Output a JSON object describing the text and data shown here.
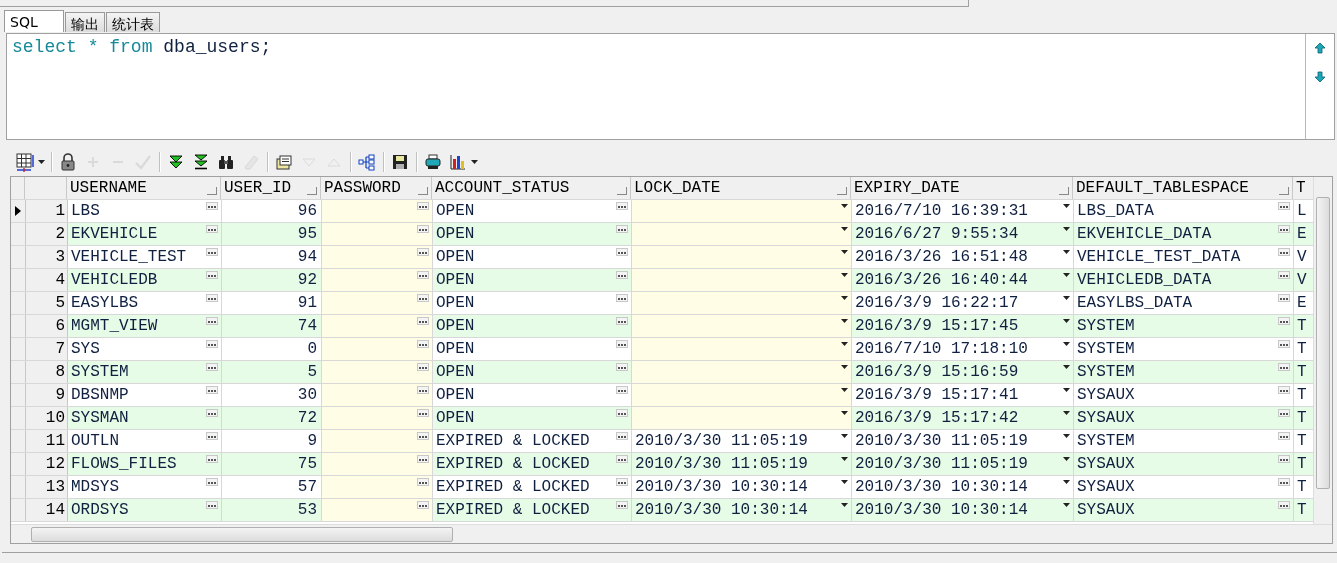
{
  "tabs": [
    {
      "label": "SQL",
      "selected": true
    },
    {
      "label": "输出",
      "selected": false
    },
    {
      "label": "统计表",
      "selected": false
    }
  ],
  "sql": [
    {
      "text": "select",
      "kind": "keyword"
    },
    {
      "text": "*",
      "kind": "keyword"
    },
    {
      "text": "from",
      "kind": "keyword"
    },
    {
      "text": "dba_users;",
      "kind": "ident"
    }
  ],
  "toolbar": [
    {
      "kind": "grid",
      "disabled": false,
      "menu": true
    },
    {
      "kind": "sep"
    },
    {
      "kind": "lock",
      "disabled": false
    },
    {
      "kind": "plus",
      "disabled": true
    },
    {
      "kind": "minus",
      "disabled": true
    },
    {
      "kind": "check",
      "disabled": true
    },
    {
      "kind": "sep"
    },
    {
      "kind": "next",
      "disabled": false
    },
    {
      "kind": "last",
      "disabled": false
    },
    {
      "kind": "find",
      "disabled": false
    },
    {
      "kind": "eraser",
      "disabled": true
    },
    {
      "kind": "sep"
    },
    {
      "kind": "query",
      "disabled": false
    },
    {
      "kind": "down",
      "disabled": true
    },
    {
      "kind": "up",
      "disabled": true
    },
    {
      "kind": "sep"
    },
    {
      "kind": "tree",
      "disabled": false
    },
    {
      "kind": "sep"
    },
    {
      "kind": "save",
      "disabled": false
    },
    {
      "kind": "sep"
    },
    {
      "kind": "print",
      "disabled": false
    },
    {
      "kind": "chart",
      "disabled": false,
      "menu": true
    }
  ],
  "table": {
    "columns": [
      {
        "label": "USERNAME",
        "kind": "text"
      },
      {
        "label": "USER_ID",
        "kind": "number"
      },
      {
        "label": "PASSWORD",
        "kind": "text"
      },
      {
        "label": "ACCOUNT_STATUS",
        "kind": "text"
      },
      {
        "label": "LOCK_DATE",
        "kind": "date"
      },
      {
        "label": "EXPIRY_DATE",
        "kind": "date"
      },
      {
        "label": "DEFAULT_TABLESPACE",
        "kind": "text"
      },
      {
        "label": "T",
        "kind": "plain"
      }
    ],
    "rows": [
      {
        "number": "1",
        "selected": true,
        "cells": [
          "LBS",
          "96",
          null,
          "OPEN",
          null,
          "2016/7/10 16:39:31",
          "LBS_DATA",
          "L"
        ]
      },
      {
        "number": "2",
        "selected": false,
        "cells": [
          "EKVEHICLE",
          "95",
          null,
          "OPEN",
          null,
          "2016/6/27 9:55:34",
          "EKVEHICLE_DATA",
          "E"
        ]
      },
      {
        "number": "3",
        "selected": false,
        "cells": [
          "VEHICLE_TEST",
          "94",
          null,
          "OPEN",
          null,
          "2016/3/26 16:51:48",
          "VEHICLE_TEST_DATA",
          "V"
        ]
      },
      {
        "number": "4",
        "selected": false,
        "cells": [
          "VEHICLEDB",
          "92",
          null,
          "OPEN",
          null,
          "2016/3/26 16:40:44",
          "VEHICLEDB_DATA",
          "V"
        ]
      },
      {
        "number": "5",
        "selected": false,
        "cells": [
          "EASYLBS",
          "91",
          null,
          "OPEN",
          null,
          "2016/3/9 16:22:17",
          "EASYLBS_DATA",
          "E"
        ]
      },
      {
        "number": "6",
        "selected": false,
        "cells": [
          "MGMT_VIEW",
          "74",
          null,
          "OPEN",
          null,
          "2016/3/9 15:17:45",
          "SYSTEM",
          "T"
        ]
      },
      {
        "number": "7",
        "selected": false,
        "cells": [
          "SYS",
          "0",
          null,
          "OPEN",
          null,
          "2016/7/10 17:18:10",
          "SYSTEM",
          "T"
        ]
      },
      {
        "number": "8",
        "selected": false,
        "cells": [
          "SYSTEM",
          "5",
          null,
          "OPEN",
          null,
          "2016/3/9 15:16:59",
          "SYSTEM",
          "T"
        ]
      },
      {
        "number": "9",
        "selected": false,
        "cells": [
          "DBSNMP",
          "30",
          null,
          "OPEN",
          null,
          "2016/3/9 15:17:41",
          "SYSAUX",
          "T"
        ]
      },
      {
        "number": "10",
        "selected": false,
        "cells": [
          "SYSMAN",
          "72",
          null,
          "OPEN",
          null,
          "2016/3/9 15:17:42",
          "SYSAUX",
          "T"
        ]
      },
      {
        "number": "11",
        "selected": false,
        "cells": [
          "OUTLN",
          "9",
          null,
          "EXPIRED & LOCKED",
          "2010/3/30 11:05:19",
          "2010/3/30 11:05:19",
          "SYSTEM",
          "T"
        ]
      },
      {
        "number": "12",
        "selected": false,
        "cells": [
          "FLOWS_FILES",
          "75",
          null,
          "EXPIRED & LOCKED",
          "2010/3/30 11:05:19",
          "2010/3/30 11:05:19",
          "SYSAUX",
          "T"
        ]
      },
      {
        "number": "13",
        "selected": false,
        "cells": [
          "MDSYS",
          "57",
          null,
          "EXPIRED & LOCKED",
          "2010/3/30 10:30:14",
          "2010/3/30 10:30:14",
          "SYSAUX",
          "T"
        ]
      },
      {
        "number": "14",
        "selected": false,
        "cells": [
          "ORDSYS",
          "53",
          null,
          "EXPIRED & LOCKED",
          "2010/3/30 10:30:14",
          "2010/3/30 10:30:14",
          "SYSAUX",
          "T"
        ]
      }
    ]
  }
}
